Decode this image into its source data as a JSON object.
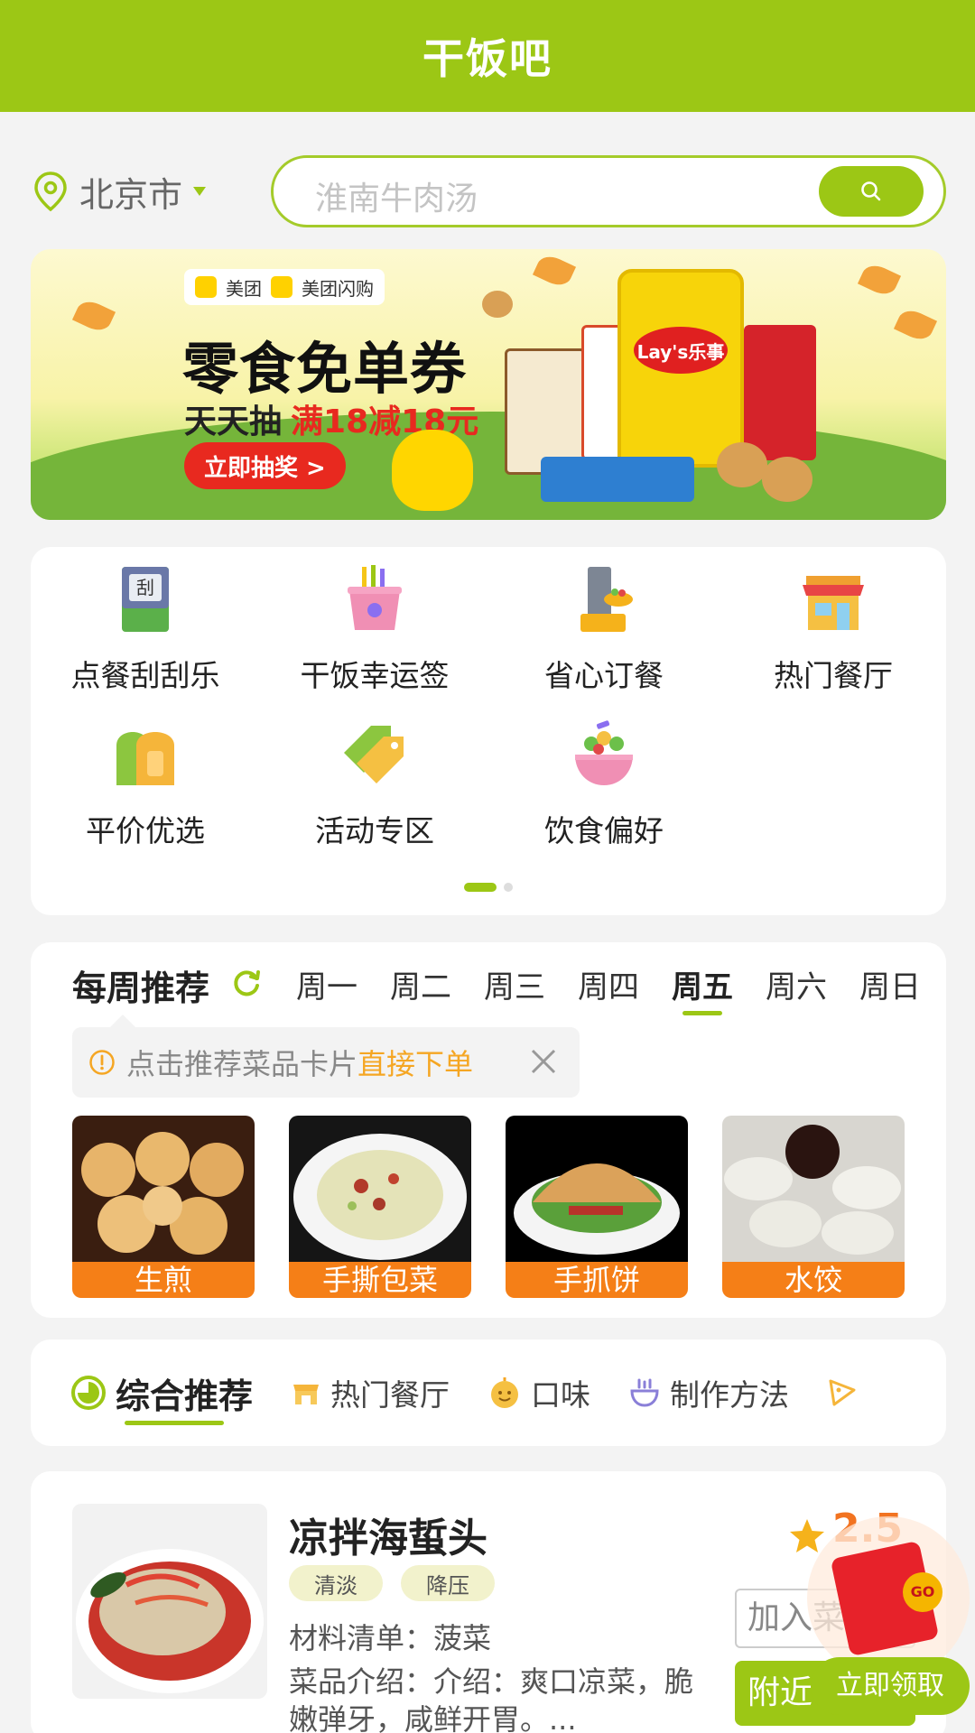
{
  "header": {
    "title": "干饭吧"
  },
  "location": {
    "city": "北京市"
  },
  "search": {
    "placeholder": "淮南牛肉汤"
  },
  "banner": {
    "brand_1": "美团",
    "brand_2": "美团闪购",
    "headline": "零食免单券",
    "sub_prefix": "天天抽",
    "sub_highlight": "满18减18元",
    "cta": "立即抽奖 >",
    "snack_logo": "Lay's乐事"
  },
  "features": [
    {
      "label": "点餐刮刮乐",
      "icon": "scratch-card-icon"
    },
    {
      "label": "干饭幸运签",
      "icon": "lucky-stick-icon"
    },
    {
      "label": "省心订餐",
      "icon": "order-icon"
    },
    {
      "label": "热门餐厅",
      "icon": "restaurant-icon"
    },
    {
      "label": "平价优选",
      "icon": "bread-icon"
    },
    {
      "label": "活动专区",
      "icon": "tag-icon"
    },
    {
      "label": "饮食偏好",
      "icon": "salad-bowl-icon"
    }
  ],
  "weekly": {
    "title": "每周推荐",
    "days": [
      "周一",
      "周二",
      "周三",
      "周四",
      "周五",
      "周六",
      "周日"
    ],
    "active_day": "周五",
    "tip_prefix": "点击推荐菜品卡片",
    "tip_highlight": "直接下单",
    "dishes": [
      "生煎",
      "手撕包菜",
      "手抓饼",
      "水饺"
    ]
  },
  "categories": {
    "tabs": [
      "综合推荐",
      "热门餐厅",
      "口味",
      "制作方法"
    ],
    "active": "综合推荐"
  },
  "recipe": {
    "name": "凉拌海蜇头",
    "tags": [
      "清淡",
      "降压"
    ],
    "materials": "材料清单：菠菜",
    "intro": "菜品介绍：介绍：爽口凉菜，脆嫩弹牙，咸鲜开胃。...",
    "score": "2.5",
    "add_button": "加入菜",
    "near_button": "附近"
  },
  "float_ad": {
    "claim": "立即领取",
    "seal": "GO"
  },
  "colors": {
    "primary": "#9cc715",
    "orange": "#f57f17",
    "accent_red": "#e8291f"
  }
}
